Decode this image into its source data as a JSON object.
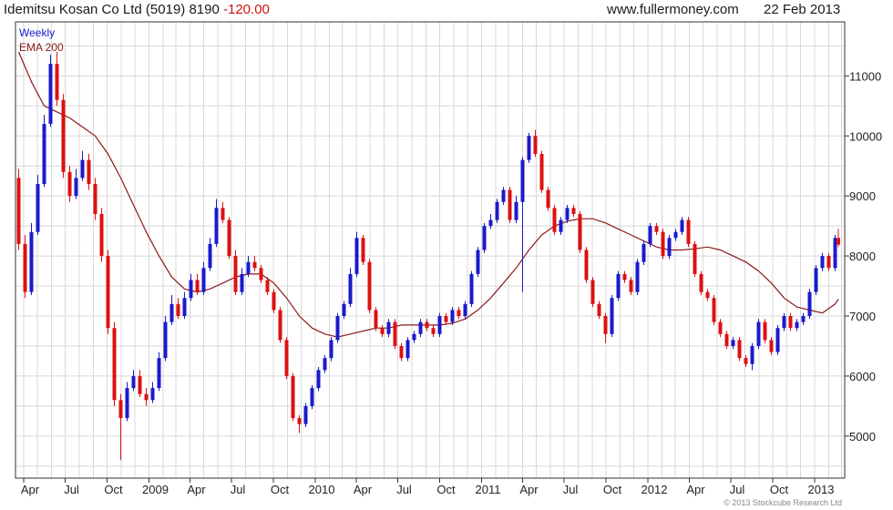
{
  "header": {
    "title": "Idemitsu Kosan Co Ltd (5019) 8190",
    "change": "-120.00",
    "source": "www.fullermoney.com",
    "date": "22 Feb 2013"
  },
  "footer": {
    "copyright": "© 2013 Stockcube Research Ltd"
  },
  "colors": {
    "up": "#1a1acc",
    "down": "#dd1111",
    "ema": "#8b1a1a",
    "grid": "#d8d8d8",
    "frame": "#333333"
  },
  "chart_data": {
    "type": "candlestick",
    "legend": [
      "Weekly",
      "EMA 200"
    ],
    "ylim": [
      4300,
      11900
    ],
    "yticks": [
      5000,
      6000,
      7000,
      8000,
      9000,
      10000,
      11000
    ],
    "xlabels": [
      "Apr",
      "Jul",
      "Oct",
      "2009",
      "Apr",
      "Jul",
      "Oct",
      "2010",
      "Apr",
      "Jul",
      "Oct",
      "2011",
      "Apr",
      "Jul",
      "Oct",
      "2012",
      "Apr",
      "Jul",
      "Oct",
      "2013"
    ],
    "xlim": [
      "2008-03-14",
      "2013-03-08"
    ],
    "grid": true,
    "price_series": {
      "name": "Weekly",
      "dates": [
        "2008-03-21",
        "2008-04-04",
        "2008-04-18",
        "2008-05-02",
        "2008-05-16",
        "2008-05-30",
        "2008-06-13",
        "2008-06-27",
        "2008-07-11",
        "2008-07-25",
        "2008-08-08",
        "2008-08-22",
        "2008-09-05",
        "2008-09-19",
        "2008-10-03",
        "2008-10-17",
        "2008-10-31",
        "2008-11-14",
        "2008-11-28",
        "2008-12-12",
        "2008-12-26",
        "2009-01-09",
        "2009-01-23",
        "2009-02-06",
        "2009-02-20",
        "2009-03-06",
        "2009-03-20",
        "2009-04-03",
        "2009-04-17",
        "2009-05-01",
        "2009-05-15",
        "2009-05-29",
        "2009-06-12",
        "2009-06-26",
        "2009-07-10",
        "2009-07-24",
        "2009-08-07",
        "2009-08-21",
        "2009-09-04",
        "2009-09-18",
        "2009-10-02",
        "2009-10-16",
        "2009-10-30",
        "2009-11-13",
        "2009-11-27",
        "2009-12-11",
        "2009-12-25",
        "2010-01-08",
        "2010-01-22",
        "2010-02-05",
        "2010-02-19",
        "2010-03-05",
        "2010-03-19",
        "2010-04-02",
        "2010-04-16",
        "2010-04-30",
        "2010-05-14",
        "2010-05-28",
        "2010-06-11",
        "2010-06-25",
        "2010-07-09",
        "2010-07-23",
        "2010-08-06",
        "2010-08-20",
        "2010-09-03",
        "2010-09-17",
        "2010-10-01",
        "2010-10-15",
        "2010-10-29",
        "2010-11-12",
        "2010-11-26",
        "2010-12-10",
        "2010-12-24",
        "2011-01-07",
        "2011-01-21",
        "2011-02-04",
        "2011-02-18",
        "2011-03-04",
        "2011-03-18",
        "2011-04-01",
        "2011-04-15",
        "2011-04-29",
        "2011-05-13",
        "2011-05-27",
        "2011-06-10",
        "2011-06-24",
        "2011-07-08",
        "2011-07-22",
        "2011-08-05",
        "2011-08-19",
        "2011-09-02",
        "2011-09-16",
        "2011-09-30",
        "2011-10-14",
        "2011-10-28",
        "2011-11-11",
        "2011-11-25",
        "2011-12-09",
        "2011-12-23",
        "2012-01-06",
        "2012-01-20",
        "2012-02-03",
        "2012-02-17",
        "2012-03-02",
        "2012-03-16",
        "2012-03-30",
        "2012-04-13",
        "2012-04-27",
        "2012-05-11",
        "2012-05-25",
        "2012-06-08",
        "2012-06-22",
        "2012-07-06",
        "2012-07-20",
        "2012-08-03",
        "2012-08-17",
        "2012-08-31",
        "2012-09-14",
        "2012-09-28",
        "2012-10-12",
        "2012-10-26",
        "2012-11-09",
        "2012-11-23",
        "2012-12-07",
        "2012-12-21",
        "2013-01-04",
        "2013-01-18",
        "2013-02-01",
        "2013-02-15",
        "2013-02-22"
      ],
      "open": [
        9300,
        8200,
        7400,
        8400,
        9200,
        10200,
        11200,
        10600,
        9400,
        9000,
        9300,
        9600,
        9200,
        8700,
        8000,
        6800,
        5600,
        5300,
        5800,
        6000,
        5700,
        5600,
        5800,
        6300,
        6900,
        7200,
        7000,
        7300,
        7600,
        7400,
        7800,
        8200,
        8800,
        8600,
        8000,
        7400,
        7700,
        7900,
        7800,
        7600,
        7400,
        7100,
        6600,
        6000,
        5300,
        5200,
        5500,
        5800,
        6100,
        6300,
        6600,
        7000,
        7200,
        7700,
        8300,
        7900,
        7100,
        6800,
        6700,
        6900,
        6500,
        6300,
        6600,
        6700,
        6900,
        6800,
        6700,
        7000,
        6900,
        7100,
        7000,
        7200,
        7700,
        8100,
        8500,
        8600,
        8900,
        9100,
        8600,
        8900,
        9600,
        10000,
        9700,
        9100,
        8800,
        8400,
        8600,
        8800,
        8700,
        8100,
        7600,
        7200,
        7000,
        6700,
        7300,
        7700,
        7600,
        7400,
        7900,
        8200,
        8500,
        8400,
        8000,
        8300,
        8400,
        8600,
        8200,
        7700,
        7400,
        7300,
        6900,
        6700,
        6500,
        6600,
        6300,
        6200,
        6500,
        6900,
        6600,
        6400,
        6800,
        7000,
        6800,
        6900,
        7000,
        7400,
        7800,
        8000,
        7800,
        8300
      ],
      "close": [
        8200,
        7400,
        8400,
        9200,
        10200,
        11200,
        10600,
        9400,
        9000,
        9300,
        9600,
        9200,
        8700,
        8000,
        6800,
        5600,
        5300,
        5800,
        6000,
        5700,
        5600,
        5800,
        6300,
        6900,
        7200,
        7000,
        7300,
        7600,
        7400,
        7800,
        8200,
        8800,
        8600,
        8000,
        7400,
        7700,
        7900,
        7800,
        7600,
        7400,
        7100,
        6600,
        6000,
        5300,
        5200,
        5500,
        5800,
        6100,
        6300,
        6600,
        7000,
        7200,
        7700,
        8300,
        7900,
        7100,
        6800,
        6700,
        6900,
        6500,
        6300,
        6600,
        6700,
        6900,
        6800,
        6700,
        7000,
        6900,
        7100,
        7000,
        7200,
        7700,
        8100,
        8500,
        8600,
        8900,
        9100,
        8600,
        8900,
        9600,
        10000,
        9700,
        9100,
        8800,
        8400,
        8600,
        8800,
        8700,
        8100,
        7600,
        7200,
        7000,
        6700,
        7300,
        7700,
        7600,
        7400,
        7900,
        8200,
        8500,
        8400,
        8000,
        8300,
        8400,
        8600,
        8200,
        7700,
        7400,
        7300,
        6900,
        6700,
        6500,
        6600,
        6300,
        6200,
        6500,
        6900,
        6600,
        6400,
        6800,
        7000,
        6800,
        6900,
        7000,
        7400,
        7800,
        8000,
        7800,
        8300,
        8190
      ],
      "high": [
        9450,
        8350,
        8550,
        9350,
        10350,
        11350,
        11400,
        10700,
        9500,
        9450,
        9750,
        9700,
        9300,
        8800,
        8100,
        6900,
        5700,
        5900,
        6100,
        6100,
        5800,
        5900,
        6400,
        7000,
        7350,
        7300,
        7400,
        7700,
        7700,
        7900,
        8300,
        8950,
        8900,
        8650,
        8100,
        7800,
        8000,
        8000,
        7850,
        7650,
        7450,
        7150,
        6650,
        6050,
        5350,
        5550,
        5850,
        6150,
        6350,
        6650,
        7050,
        7250,
        7800,
        8400,
        8350,
        7950,
        7150,
        6850,
        6950,
        6950,
        6550,
        6650,
        6750,
        6950,
        6950,
        6850,
        7050,
        7050,
        7150,
        7150,
        7250,
        7750,
        8150,
        8550,
        8700,
        8950,
        9150,
        9150,
        9000,
        9650,
        10050,
        10100,
        9750,
        9150,
        8850,
        8650,
        8850,
        8850,
        8750,
        8150,
        7650,
        7250,
        7050,
        7350,
        7750,
        7750,
        7650,
        7950,
        8250,
        8550,
        8550,
        8450,
        8350,
        8450,
        8650,
        8650,
        8250,
        7750,
        7450,
        7350,
        6950,
        6750,
        6650,
        6650,
        6350,
        6550,
        6950,
        6950,
        6650,
        6850,
        7050,
        7050,
        6950,
        7050,
        7450,
        7850,
        8050,
        8050,
        8350,
        8450
      ],
      "low": [
        8100,
        7300,
        7350,
        8350,
        9150,
        10150,
        10500,
        9300,
        8900,
        8950,
        9250,
        9100,
        8600,
        7900,
        6700,
        5500,
        4600,
        5250,
        5750,
        5650,
        5500,
        5550,
        5750,
        6250,
        6850,
        6950,
        6950,
        7250,
        7350,
        7350,
        7750,
        8150,
        8550,
        7950,
        7350,
        7350,
        7650,
        7750,
        7550,
        7350,
        7050,
        6550,
        5950,
        5250,
        5050,
        5150,
        5450,
        5750,
        6050,
        6250,
        6550,
        6950,
        7150,
        7650,
        7850,
        7050,
        6750,
        6650,
        6650,
        6450,
        6250,
        6250,
        6550,
        6650,
        6750,
        6650,
        6650,
        6850,
        6850,
        6950,
        6950,
        7150,
        7650,
        8050,
        8450,
        8550,
        8850,
        8550,
        8550,
        7400,
        9550,
        9650,
        9050,
        8750,
        8350,
        8350,
        8550,
        8650,
        8050,
        7550,
        7150,
        6950,
        6550,
        6650,
        7250,
        7550,
        7350,
        7350,
        7850,
        8150,
        8350,
        7950,
        7950,
        8250,
        8350,
        8150,
        7650,
        7350,
        7250,
        6850,
        6650,
        6450,
        6450,
        6250,
        6150,
        6100,
        6450,
        6550,
        6350,
        6350,
        6750,
        6750,
        6750,
        6850,
        6950,
        7350,
        7750,
        7750,
        7750,
        8150
      ]
    },
    "ema_series": {
      "name": "EMA 200",
      "dates": [
        "2008-03-21",
        "2008-04-18",
        "2008-05-16",
        "2008-06-13",
        "2008-07-11",
        "2008-08-08",
        "2008-09-05",
        "2008-10-03",
        "2008-10-31",
        "2008-11-28",
        "2008-12-26",
        "2009-01-23",
        "2009-02-20",
        "2009-03-20",
        "2009-04-17",
        "2009-05-15",
        "2009-06-12",
        "2009-07-10",
        "2009-08-07",
        "2009-09-04",
        "2009-10-02",
        "2009-10-30",
        "2009-11-27",
        "2009-12-25",
        "2010-01-22",
        "2010-02-19",
        "2010-03-19",
        "2010-04-16",
        "2010-05-14",
        "2010-06-11",
        "2010-07-09",
        "2010-08-06",
        "2010-09-03",
        "2010-10-01",
        "2010-10-29",
        "2010-11-26",
        "2010-12-24",
        "2011-01-21",
        "2011-02-18",
        "2011-03-18",
        "2011-04-15",
        "2011-05-13",
        "2011-06-10",
        "2011-07-08",
        "2011-08-05",
        "2011-09-02",
        "2011-09-30",
        "2011-10-28",
        "2011-11-25",
        "2011-12-23",
        "2012-01-20",
        "2012-02-17",
        "2012-03-16",
        "2012-04-13",
        "2012-05-11",
        "2012-06-08",
        "2012-07-06",
        "2012-08-03",
        "2012-08-31",
        "2012-09-28",
        "2012-10-26",
        "2012-11-23",
        "2012-12-21",
        "2013-01-18",
        "2013-02-15",
        "2013-02-22"
      ],
      "values": [
        11400,
        10900,
        10500,
        10400,
        10300,
        10150,
        10000,
        9700,
        9300,
        8850,
        8400,
        8000,
        7650,
        7450,
        7400,
        7450,
        7550,
        7650,
        7700,
        7700,
        7550,
        7300,
        7000,
        6800,
        6700,
        6650,
        6700,
        6750,
        6800,
        6800,
        6850,
        6850,
        6850,
        6850,
        6880,
        6950,
        7100,
        7300,
        7550,
        7800,
        8100,
        8350,
        8500,
        8580,
        8620,
        8620,
        8550,
        8450,
        8350,
        8250,
        8150,
        8100,
        8100,
        8120,
        8150,
        8100,
        8000,
        7900,
        7750,
        7550,
        7300,
        7150,
        7100,
        7050,
        7200,
        7280
      ]
    }
  }
}
